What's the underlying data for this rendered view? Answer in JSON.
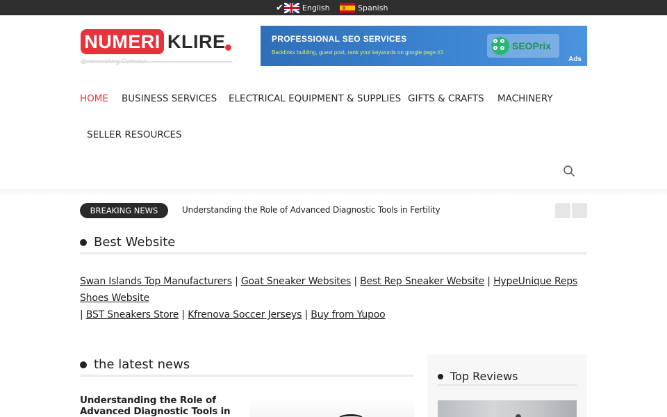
{
  "langbar": {
    "english": "English",
    "spanish": "Spanish"
  },
  "logo": {
    "part1": "NUMERI",
    "part2": "KLIRE",
    "tagline": "@numerirking.Common"
  },
  "ad": {
    "title": "PROFESSIONAL SEO SERVICES",
    "subtitle": "Backlinks building, guest post, rank your keywords on google page #1",
    "brand": "SEOPrix",
    "tag": "Ads"
  },
  "nav": {
    "items": [
      "HOME",
      "BUSINESS SERVICES",
      "ELECTRICAL EQUIPMENT & SUPPLIES",
      "GIFTS & CRAFTS",
      "MACHINERY",
      "SELLER RESOURCES"
    ]
  },
  "breaking": {
    "label": "BREAKING NEWS",
    "headline": "Understanding the Role of Advanced Diagnostic Tools in Fertility"
  },
  "best_website": {
    "title": "Best Website",
    "links": [
      "Swan Islands Top Manufacturers",
      "Goat Sneaker Websites",
      "Best Rep Sneaker Website",
      "HypeUnique Reps Shoes Website",
      "BST Sneakers Store",
      "Kfrenova Soccer Jerseys",
      "Buy from Yupoo"
    ],
    "separator": "|"
  },
  "latest_news": {
    "title": "the latest news",
    "article_title": "Understanding the Role of Advanced Diagnostic Tools in"
  },
  "sidebar": {
    "title": "Top Reviews"
  },
  "colors": {
    "accent": "#e8323c",
    "dark": "#2a2a2a",
    "ad_blue": "#3d85d4"
  }
}
